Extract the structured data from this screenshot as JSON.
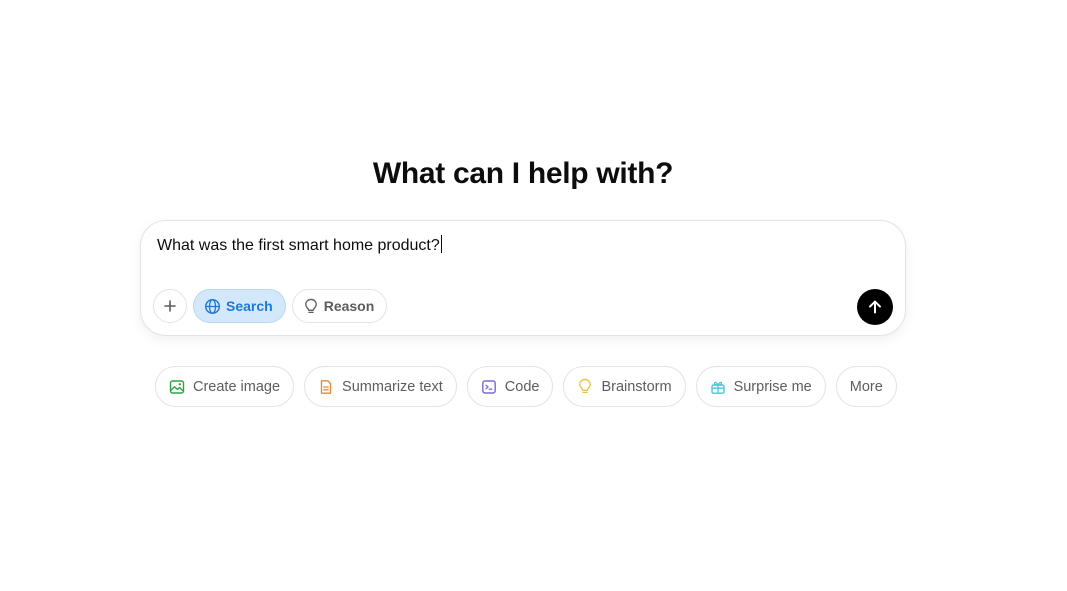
{
  "heading": "What can I help with?",
  "composer": {
    "input_value": "What was the first smart home product?",
    "tools": {
      "plus_label": "+",
      "search_label": "Search",
      "reason_label": "Reason"
    },
    "send_icon": "arrow-up-icon"
  },
  "chips": [
    {
      "label": "Create image",
      "icon": "image-icon",
      "color": "#2fa34a"
    },
    {
      "label": "Summarize text",
      "icon": "document-icon",
      "color": "#e58a3c"
    },
    {
      "label": "Code",
      "icon": "terminal-icon",
      "color": "#7b6ad8"
    },
    {
      "label": "Brainstorm",
      "icon": "lightbulb-icon",
      "color": "#e2c541"
    },
    {
      "label": "Surprise me",
      "icon": "gift-icon",
      "color": "#4ec3e0"
    },
    {
      "label": "More",
      "icon": "",
      "color": ""
    }
  ],
  "colors": {
    "search_accent": "#1a7ad4",
    "search_bg": "#d4e8fb",
    "send_bg": "#000000"
  }
}
